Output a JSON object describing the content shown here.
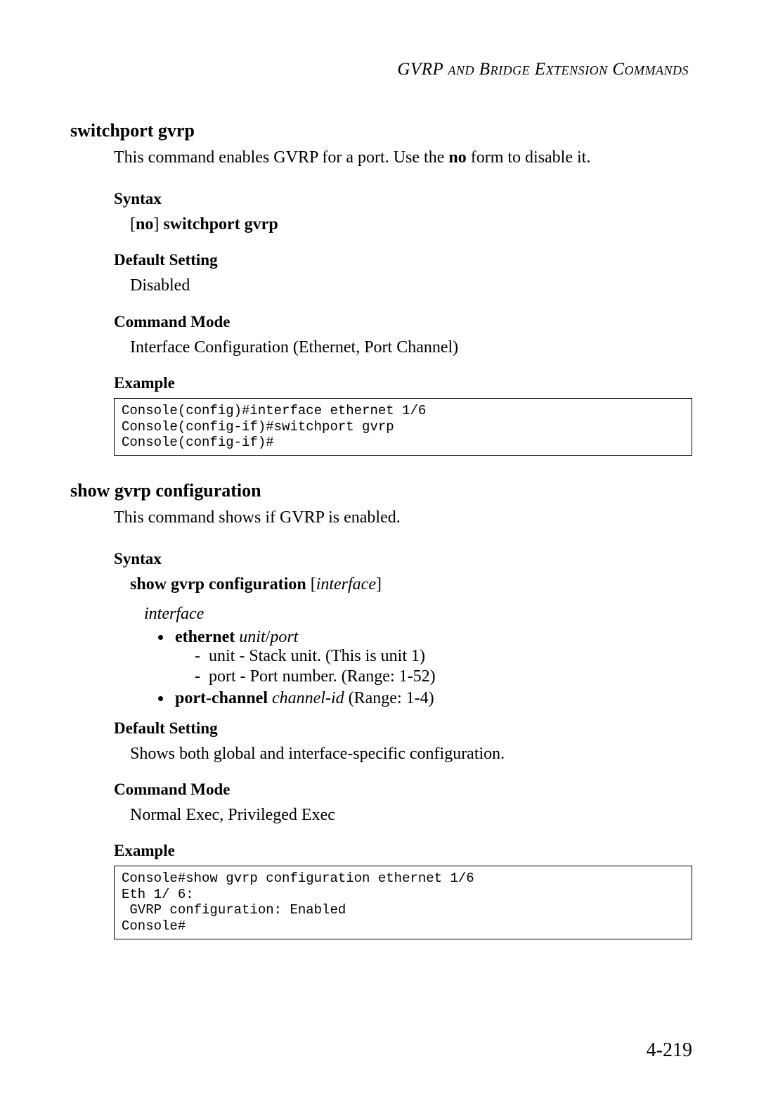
{
  "header": "GVRP and Bridge Extension Commands",
  "cmd1": {
    "title": "switchport gvrp",
    "desc_pre": "This command enables GVRP for a port. Use the ",
    "desc_bold": "no",
    "desc_post": " form to disable it.",
    "syntax_label": "Syntax",
    "syntax_value_pre": "[",
    "syntax_value_bold1": "no",
    "syntax_value_mid": "] ",
    "syntax_value_bold2": "switchport gvrp",
    "default_label": "Default Setting",
    "default_value": "Disabled",
    "mode_label": "Command Mode",
    "mode_value": "Interface Configuration (Ethernet, Port Channel)",
    "example_label": "Example",
    "example_code": "Console(config)#interface ethernet 1/6\nConsole(config-if)#switchport gvrp\nConsole(config-if)#"
  },
  "cmd2": {
    "title": "show gvrp configuration",
    "desc": "This command shows if GVRP is enabled.",
    "syntax_label": "Syntax",
    "syntax_bold": "show gvrp configuration",
    "syntax_italic": "interface",
    "param_interface": "interface",
    "eth_bold": "ethernet",
    "eth_italic": " unit",
    "eth_sep": "/",
    "eth_italic2": "port",
    "eth_unit": "unit - Stack unit. (This is unit 1)",
    "eth_port": "port - Port number. (Range: 1-52)",
    "pc_bold": "port-channel",
    "pc_italic": " channel-id",
    "pc_rest": " (Range: 1-4)",
    "default_label": "Default Setting",
    "default_value": "Shows both global and interface-specific configuration.",
    "mode_label": "Command Mode",
    "mode_value": "Normal Exec, Privileged Exec",
    "example_label": "Example",
    "example_code": "Console#show gvrp configuration ethernet 1/6\nEth 1/ 6:\n GVRP configuration: Enabled\nConsole#"
  },
  "page_number": "4-219"
}
